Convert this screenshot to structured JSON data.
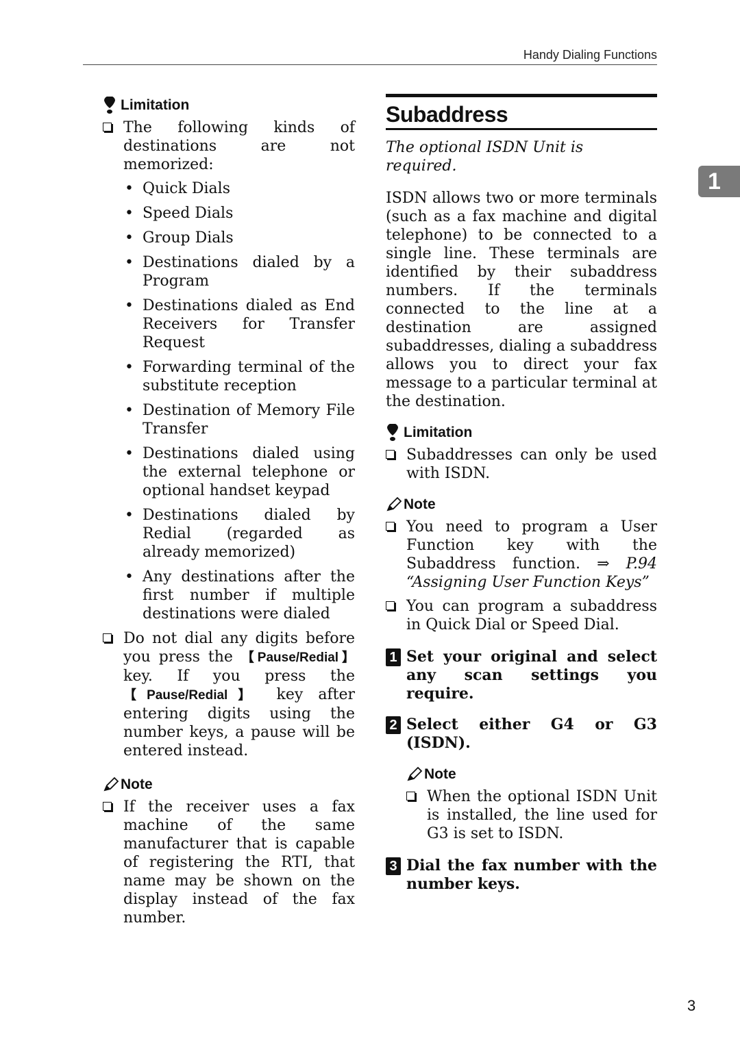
{
  "header": {
    "running_title": "Handy Dialing Functions"
  },
  "chapter_tab": "1",
  "page_number": "3",
  "left": {
    "limitation": {
      "heading": "Limitation",
      "intro": "The following kinds of destinations are not memorized:",
      "bullets": [
        "Quick Dials",
        "Speed Dials",
        "Group Dials",
        "Destinations dialed by a Program",
        "Destinations dialed as End Receivers for Transfer Request",
        "Forwarding terminal of the substitute reception",
        "Destination of Memory File Transfer",
        "Destinations dialed using the external telephone or optional handset keypad",
        "Destinations dialed by Redial (regarded as already memorized)",
        "Any destinations after the first number if multiple destinations were dialed"
      ],
      "pause_item": {
        "part1": "Do not dial any digits before you press the ",
        "key1": "【Pause/Redial】",
        "part2": " key. If you press the ",
        "key2": "【Pause/Redial】",
        "part3": " key after entering digits using the number keys, a pause will be entered instead."
      }
    },
    "note": {
      "heading": "Note",
      "item": "If the receiver uses a fax machine of the same manufacturer that is capable of registering the RTI, that name may be shown on the display instead of the fax number."
    }
  },
  "right": {
    "title": "Subaddress",
    "requirement": "The optional ISDN Unit is required.",
    "body": "ISDN allows two or more terminals (such as a fax machine and digital telephone) to be connected to a single line. These terminals are identified by their subaddress numbers. If the terminals connected to the line at a destination are assigned subaddresses, dialing a subaddress allows you to direct your fax message to a particular terminal at the destination.",
    "limitation": {
      "heading": "Limitation",
      "item": "Subaddresses can only be used with ISDN."
    },
    "note": {
      "heading": "Note",
      "item1_text": "You need to program a User Function key with the Subaddress function.",
      "item1_ref": "⇒ P.94 “Assigning User Function Keys”",
      "item2": "You can program a subaddress in Quick Dial or Speed Dial."
    },
    "steps": [
      {
        "num": "1",
        "text": "Set your original and select any scan settings you require."
      },
      {
        "num": "2",
        "text": "Select either G4 or G3 (ISDN)."
      },
      {
        "num": "3",
        "text": "Dial the fax number with the number keys."
      }
    ],
    "step2_note": {
      "heading": "Note",
      "item": "When the optional ISDN Unit is installed, the line used for G3 is set to ISDN."
    }
  }
}
